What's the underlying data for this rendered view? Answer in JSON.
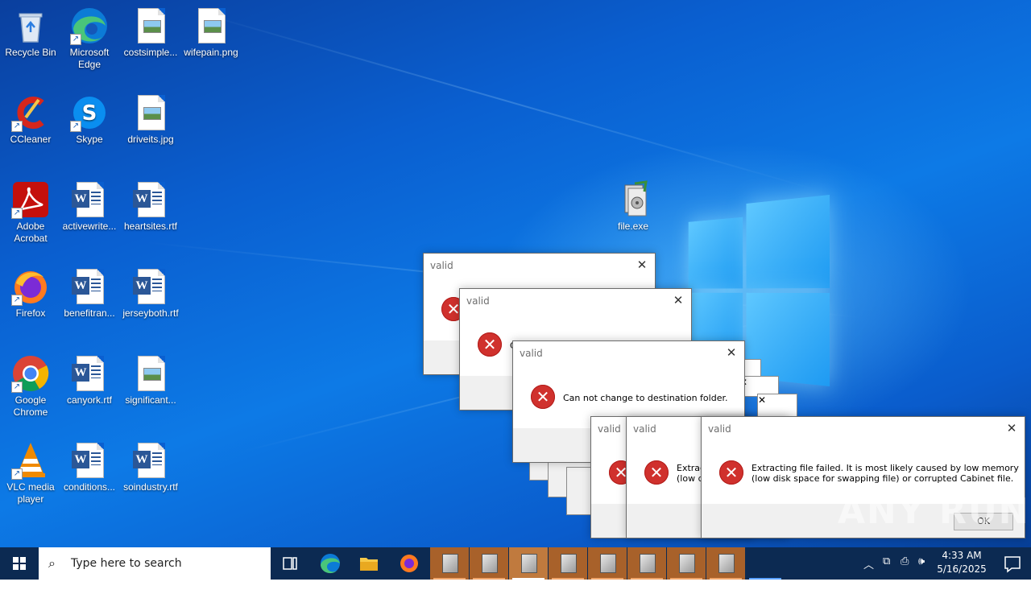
{
  "desktop": {
    "icons": [
      {
        "label": "Recycle Bin",
        "icon": "recycle-bin-icon"
      },
      {
        "label": "Microsoft Edge",
        "icon": "edge-icon"
      },
      {
        "label": "costsimple...",
        "icon": "image-file-icon"
      },
      {
        "label": "wifepain.png",
        "icon": "image-file-icon"
      },
      {
        "label": "CCleaner",
        "icon": "ccleaner-icon"
      },
      {
        "label": "Skype",
        "icon": "skype-icon"
      },
      {
        "label": "driveits.jpg",
        "icon": "image-file-icon"
      },
      {
        "label": "Adobe Acrobat",
        "icon": "acrobat-icon"
      },
      {
        "label": "activewrite...",
        "icon": "word-doc-icon"
      },
      {
        "label": "heartsites.rtf",
        "icon": "word-doc-icon"
      },
      {
        "label": "Firefox",
        "icon": "firefox-icon"
      },
      {
        "label": "benefitran...",
        "icon": "word-doc-icon"
      },
      {
        "label": "jerseyboth.rtf",
        "icon": "word-doc-icon"
      },
      {
        "label": "Google Chrome",
        "icon": "chrome-icon"
      },
      {
        "label": "canyork.rtf",
        "icon": "word-doc-icon"
      },
      {
        "label": "significant...",
        "icon": "image-file-icon"
      },
      {
        "label": "VLC media player",
        "icon": "vlc-icon"
      },
      {
        "label": "conditions...",
        "icon": "word-doc-icon"
      },
      {
        "label": "soindustry.rtf",
        "icon": "word-doc-icon"
      },
      {
        "label": "file.exe",
        "icon": "installer-icon"
      }
    ]
  },
  "dialogs": {
    "title": "valid",
    "close_glyph": "✕",
    "error_glyph": "✕",
    "msg_partial_c": "C",
    "msg_dest": "Can not change to destination folder.",
    "msg_partial_1": "Extract",
    "msg_partial_2": "(low d",
    "msg_extract_1": "Extracting file failed.  It is most likely caused by low memory",
    "msg_extract_2": "(low disk space for swapping file) or corrupted Cabinet file.",
    "ok_label": "OK"
  },
  "watermark": "ANY  RUN",
  "taskbar": {
    "start_icon": "windows-start-icon",
    "search_placeholder": "Type here to search",
    "pinned": [
      "task-view-icon",
      "edge-icon",
      "file-explorer-icon",
      "firefox-icon"
    ],
    "running_tasks": 8,
    "clock_time": "4:33 AM",
    "clock_date": "5/16/2025"
  },
  "colors": {
    "taskbar": "#0c2a52",
    "task_highlight": "#a8612a",
    "error_red": "#d0312d",
    "desktop_blue": "#0a5fd0"
  }
}
